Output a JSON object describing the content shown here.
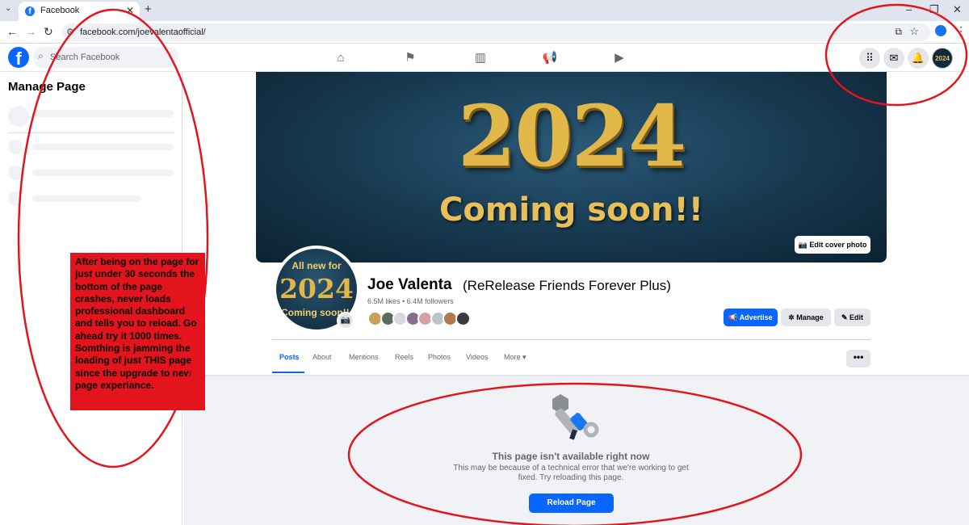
{
  "browser": {
    "tab_title": "Facebook",
    "tab_close": "✕",
    "new_tab": "+",
    "url": "facebook.com/joevalentaofficial/",
    "window_controls": [
      "–",
      "❐",
      "✕"
    ]
  },
  "facebook": {
    "logo": "f",
    "search_placeholder": "Search Facebook",
    "nav_icons": [
      "home-icon",
      "flag-icon",
      "dashboard-icon",
      "megaphone-icon",
      "video-icon"
    ],
    "right_icons": [
      "menu-grid-icon",
      "messenger-icon",
      "notifications-icon",
      "account-avatar"
    ],
    "account_avatar_text": "2024"
  },
  "sidebar": {
    "title": "Manage Page"
  },
  "cover": {
    "big_text": "2024",
    "subtext": "Coming soon!!",
    "edit_label": "Edit cover photo"
  },
  "profile_picture": {
    "line1": "All new for",
    "line2": "2024",
    "line3": "Coming soon!!"
  },
  "page": {
    "name": "Joe Valenta",
    "subname": "(ReRelease Friends Forever Plus)",
    "stats": "6.5M likes • 6.4M followers",
    "friend_avatar_colors": [
      "#c9a15a",
      "#5b6b5e",
      "#d7d9dc",
      "#8a6d8e",
      "#d4a3a0",
      "#bfc4c9",
      "#b07a4e",
      "#3b3b3b"
    ]
  },
  "actions": {
    "advertise": "Advertise",
    "manage": "Manage",
    "edit": "Edit"
  },
  "tabs": [
    "Posts",
    "About",
    "Mentions",
    "Reels",
    "Photos",
    "Videos",
    "More"
  ],
  "tabs_more_button": "•••",
  "error": {
    "title": "This page isn't available right now",
    "description": "This may be because of a technical error that we're working to get fixed. Try reloading this page.",
    "button": "Reload Page"
  },
  "annotation": {
    "note": "After being on the page for just under 30 seconds the bottom of the page crashes, never loads professional dashboard and tells you to reload. Go ahead try it 1000 times. Somthing is jamming the loading of just THIS page since the upgrade to new page experiance."
  },
  "colors": {
    "facebook_blue": "#0866ff",
    "annotation_red": "#e3141b",
    "cover_gold": "#e1b74a"
  }
}
